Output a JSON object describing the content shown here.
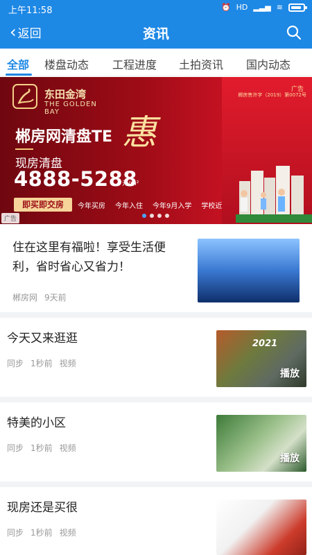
{
  "status": {
    "time": "上午11:58",
    "signal": "HD",
    "icons": [
      "alarm-icon",
      "signal-icon",
      "wifi-icon",
      "battery-icon"
    ]
  },
  "nav": {
    "back_label": "返回",
    "title": "资讯"
  },
  "tabs": [
    {
      "label": "全部",
      "active": true
    },
    {
      "label": "楼盘动态"
    },
    {
      "label": "工程进度"
    },
    {
      "label": "土拍资讯"
    },
    {
      "label": "国内动态"
    }
  ],
  "banner": {
    "brand_cn": "东田金湾",
    "brand_en": "THE GOLDEN BAY",
    "ad_tag": "广告",
    "license": "郴房售许字（2019）第0072号",
    "headline": "郴房网清盘TE",
    "hui": "惠",
    "subline": "现房清盘",
    "price": "4888-5288",
    "unit": "元/m²",
    "cta": "即买即交房",
    "bullets": [
      "今年买房",
      "今年入住",
      "今年9月入学",
      "学校近"
    ],
    "ad_label": "广告",
    "slide_count": 4,
    "active_slide": 1
  },
  "articles": [
    {
      "title_line1": "住在这里有福啦！享受生活便",
      "title_line2": "利，省时省心又省力！",
      "source": "郴房网",
      "time": "9天前"
    },
    {
      "title": "今天又来逛逛",
      "source": "同步",
      "time": "1秒前",
      "type": "视频",
      "play_label": "播放",
      "thumb_year": "2021"
    },
    {
      "title": "特美的小区",
      "source": "同步",
      "time": "1秒前",
      "type": "视频",
      "play_label": "播放"
    },
    {
      "title": "现房还是买很",
      "source": "同步",
      "time": "1秒前",
      "type": "视频"
    }
  ],
  "colors": {
    "primary": "#1e88e5",
    "banner_red": "#9e0c16",
    "gold": "#f6d49a"
  }
}
